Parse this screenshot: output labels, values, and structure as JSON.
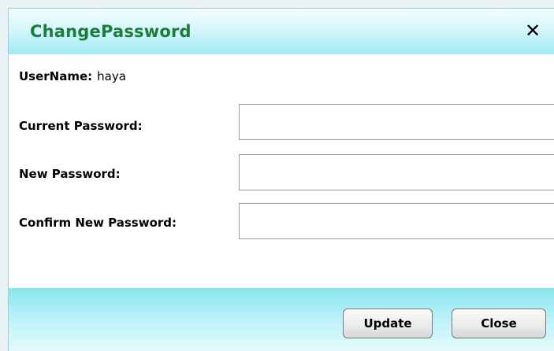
{
  "dialog": {
    "title": "ChangePassword",
    "close_glyph": "✕",
    "close_icon": "close-icon"
  },
  "username": {
    "label": "UserName:",
    "value": "haya"
  },
  "fields": [
    {
      "label": "Current Password:",
      "value": "",
      "placeholder": ""
    },
    {
      "label": "New Password:",
      "value": "",
      "placeholder": ""
    },
    {
      "label": "Confirm New Password:",
      "value": "",
      "placeholder": ""
    }
  ],
  "buttons": {
    "update_label": "Update",
    "close_label": "Close"
  },
  "colors": {
    "title_text": "#1b7d3c",
    "header_gradient_end": "#9feaf3",
    "footer_gradient_start": "#88e6f2"
  }
}
